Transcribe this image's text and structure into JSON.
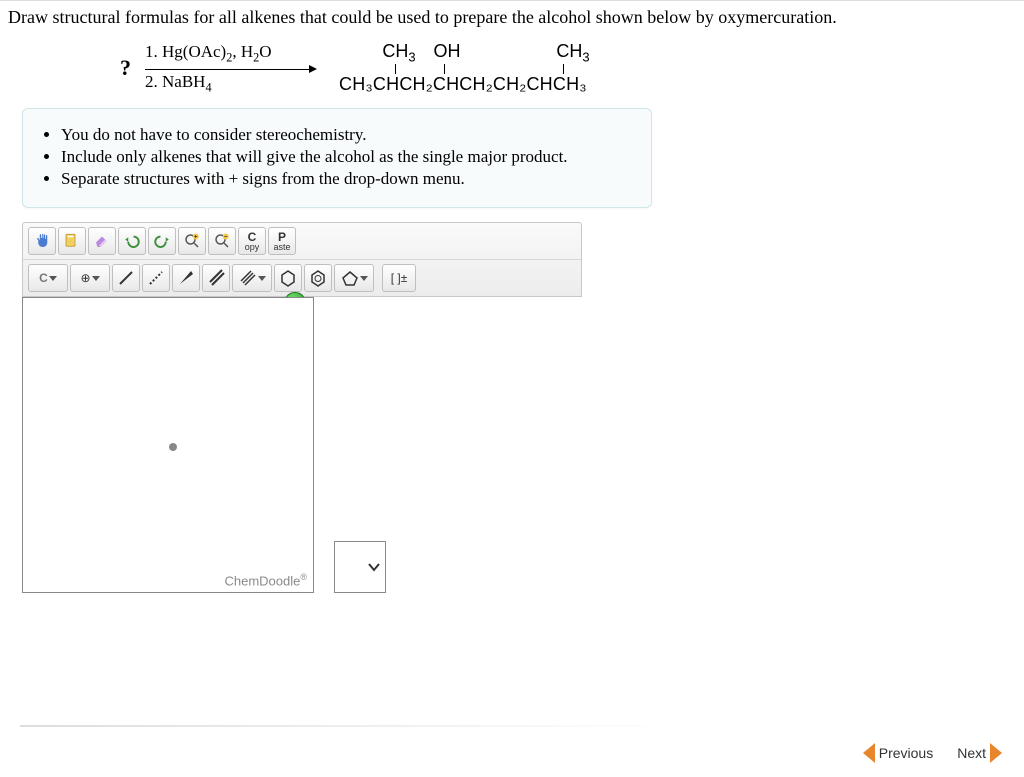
{
  "question": {
    "prompt": "Draw structural formulas for all alkenes that could be used to prepare the alcohol shown below by oxymercuration.",
    "unknown_symbol": "?",
    "reagent_1": "1. Hg(OAc)",
    "reagent_1_sub": "2",
    "reagent_1_tail": ", H",
    "reagent_1_tail_sub": "2",
    "reagent_1_end": "O",
    "reagent_2": "2. NaBH",
    "reagent_2_sub": "4",
    "product_sub_1": "CH",
    "product_sub_1b": "3",
    "product_sub_oh": "OH",
    "product_sub_2": "CH",
    "product_sub_2b": "3",
    "product_main": "CH₃CHCH₂CHCH₂CH₂CHCH₃"
  },
  "hints": {
    "h1": "You do not have to consider stereochemistry.",
    "h2": "Include only alkenes that will give the alcohol as the single major product.",
    "h3": "Separate structures with + signs from the drop-down menu."
  },
  "toolbar": {
    "row1": {
      "hand": "hand-icon",
      "lasso": "lasso-icon",
      "eraser": "eraser-icon",
      "undo": "undo-icon",
      "redo": "redo-icon",
      "zoom_in": "zoom-in-icon",
      "zoom_out": "zoom-out-icon",
      "copy_label_top": "C",
      "copy_label_bot": "opy",
      "paste_label_top": "P",
      "paste_label_bot": "aste"
    },
    "row2": {
      "element": "C",
      "charge": "⊕",
      "single": "single-bond-icon",
      "recessed": "recessed-bond-icon",
      "wedge": "wedge-bond-icon",
      "double": "double-bond-icon",
      "triple": "triple-bond-icon",
      "cyclohex": "cyclohexane-icon",
      "benzene": "benzene-icon",
      "cyclopent": "cyclopentane-icon",
      "bracket": "[ ]±"
    }
  },
  "help_badge": "?",
  "canvas": {
    "brand": "ChemDoodle",
    "reg": "®"
  },
  "nav": {
    "prev": "Previous",
    "next": "Next"
  }
}
